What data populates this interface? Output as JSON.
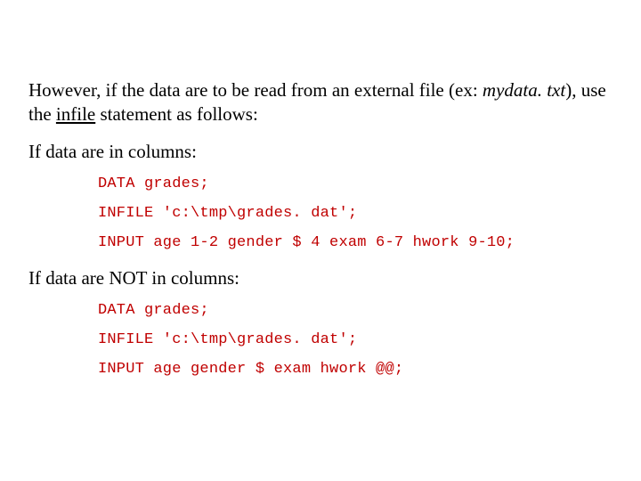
{
  "intro": {
    "t1": "However, if the data are to be read from an external file (ex: ",
    "file": "mydata. txt",
    "t2": "),  use the ",
    "kw": "infile",
    "t3": " statement as follows:"
  },
  "sec1": {
    "heading": "If data are in columns:",
    "code": {
      "l1": "DATA grades;",
      "l2": "INFILE 'c:\\tmp\\grades. dat';",
      "l3": "INPUT age 1-2 gender $ 4 exam 6-7 hwork 9-10;"
    }
  },
  "sec2": {
    "heading": "If data are NOT in columns:",
    "code": {
      "l1": "DATA grades;",
      "l2": "INFILE 'c:\\tmp\\grades. dat';",
      "l3": "INPUT age gender $ exam hwork @@;"
    }
  }
}
